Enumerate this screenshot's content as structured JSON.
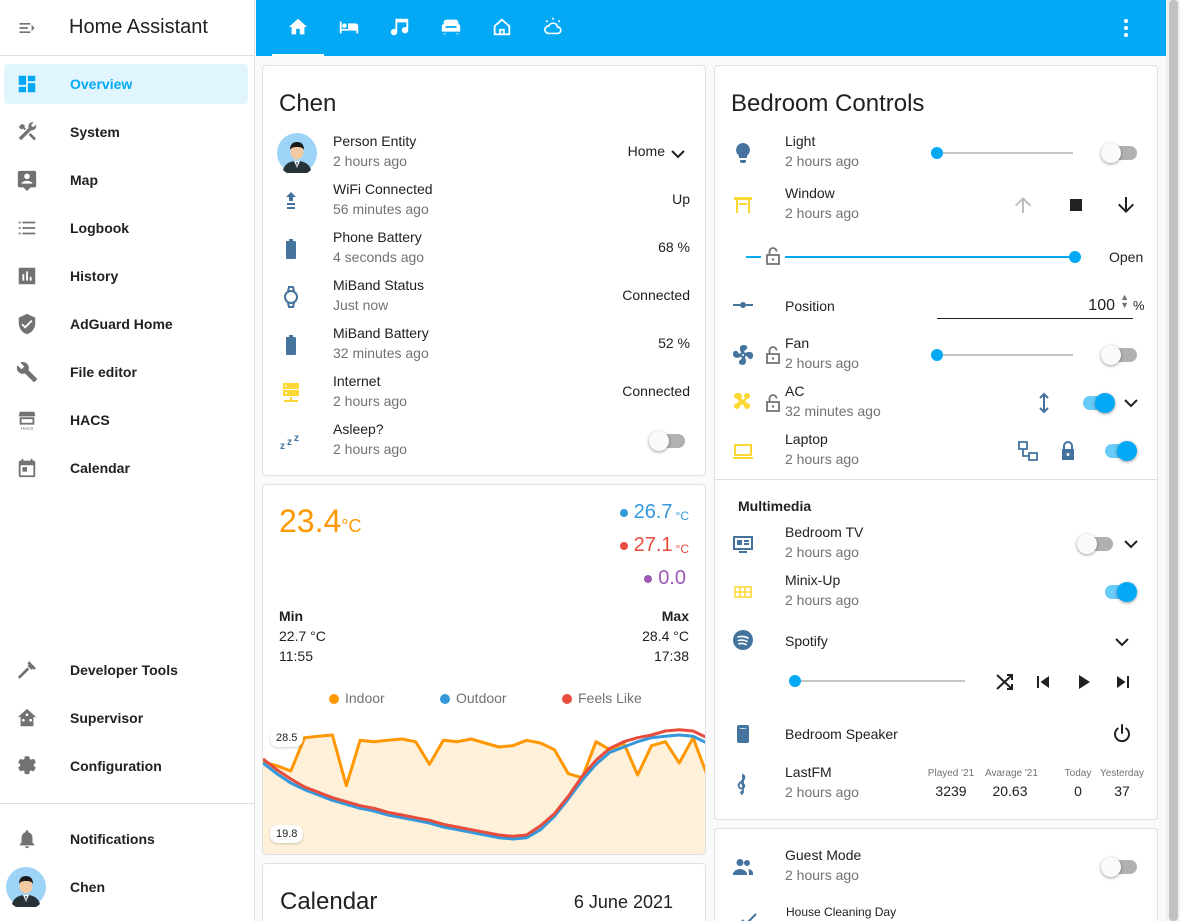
{
  "app": {
    "title": "Home Assistant"
  },
  "sidebar": {
    "items": [
      {
        "label": "Overview",
        "icon": "dashboard-icon",
        "active": true
      },
      {
        "label": "System",
        "icon": "tools-icon"
      },
      {
        "label": "Map",
        "icon": "map-account-icon"
      },
      {
        "label": "Logbook",
        "icon": "logbook-icon"
      },
      {
        "label": "History",
        "icon": "chart-box-icon"
      },
      {
        "label": "AdGuard Home",
        "icon": "shield-check-icon"
      },
      {
        "label": "File editor",
        "icon": "wrench-icon"
      },
      {
        "label": "HACS",
        "icon": "hacs-icon"
      },
      {
        "label": "Calendar",
        "icon": "calendar-icon"
      },
      {
        "label": "Developer Tools",
        "icon": "hammer-icon"
      },
      {
        "label": "Supervisor",
        "icon": "home-assistant-icon"
      },
      {
        "label": "Configuration",
        "icon": "cog-icon"
      },
      {
        "label": "Notifications",
        "icon": "bell-icon"
      },
      {
        "label": "Chen",
        "icon": "avatar"
      }
    ]
  },
  "tabs": [
    "home-icon",
    "bed-icon",
    "music-icon",
    "sofa-icon",
    "home-outline-icon",
    "weather-icon"
  ],
  "chen": {
    "title": "Chen",
    "rows": [
      {
        "name": "Person Entity",
        "sub": "2 hours ago",
        "value": "Home",
        "icon": "avatar"
      },
      {
        "name": "WiFi Connected",
        "sub": "56 minutes ago",
        "value": "Up",
        "icon": "upload-network-icon"
      },
      {
        "name": "Phone Battery",
        "sub": "4 seconds ago",
        "value": "68 %",
        "icon": "battery-icon"
      },
      {
        "name": "MiBand Status",
        "sub": "Just now",
        "value": "Connected",
        "icon": "watch-icon"
      },
      {
        "name": "MiBand Battery",
        "sub": "32 minutes ago",
        "value": "52 %",
        "icon": "battery-icon"
      },
      {
        "name": "Internet",
        "sub": "2 hours ago",
        "value": "Connected",
        "icon": "server-network-icon"
      },
      {
        "name": "Asleep?",
        "sub": "2 hours ago",
        "value": "",
        "icon": "sleep-icon",
        "toggle": false
      }
    ]
  },
  "temp": {
    "main": "23.4",
    "unit": "°C",
    "small_unit": "°C",
    "side": [
      {
        "value": "26.7",
        "unit": "°C",
        "color": "#3498db"
      },
      {
        "value": "27.1",
        "unit": "°C",
        "color": "#e74c3c"
      },
      {
        "value": "0.0",
        "unit": "",
        "color": "#9b59b6"
      }
    ],
    "min_label": "Min",
    "min_value": "22.7 °C",
    "min_time": "11:55",
    "max_label": "Max",
    "max_value": "28.4 °C",
    "max_time": "17:38",
    "legend": [
      {
        "name": "Indoor",
        "color": "#ff9800"
      },
      {
        "name": "Outdoor",
        "color": "#3498db"
      },
      {
        "name": "Feels Like",
        "color": "#e74c3c"
      }
    ],
    "y_top": "28.5",
    "y_bottom": "19.8"
  },
  "chart_data": {
    "type": "line",
    "title": "",
    "series": [
      {
        "name": "Indoor",
        "color": "#ff9800",
        "values": [
          25.9,
          25.6,
          25.2,
          27.7,
          27.8,
          27.9,
          24.1,
          27.5,
          27.4,
          27.5,
          27.6,
          27.4,
          25.7,
          27.5,
          27.4,
          27.6,
          27.3,
          27.0,
          27.1,
          27.5,
          27.3,
          26.8,
          25.0,
          24.7,
          27.4,
          26.8,
          27.3,
          24.9,
          27.1,
          27.4,
          25.8,
          27.7,
          24.9
        ]
      },
      {
        "name": "Outdoor",
        "color": "#3498db",
        "values": [
          25.8,
          25.0,
          24.3,
          23.8,
          23.4,
          23.0,
          22.7,
          22.4,
          22.2,
          21.9,
          21.7,
          21.5,
          21.3,
          21.0,
          20.8,
          20.6,
          20.4,
          20.2,
          20.1,
          20.2,
          20.8,
          21.8,
          23.1,
          24.5,
          25.7,
          26.6,
          27.0,
          27.4,
          27.7,
          27.8,
          27.9,
          27.8,
          27.3
        ]
      },
      {
        "name": "Feels Like",
        "color": "#e74c3c",
        "values": [
          26.1,
          25.3,
          24.6,
          24.0,
          23.6,
          23.2,
          22.9,
          22.6,
          22.4,
          22.1,
          21.9,
          21.7,
          21.5,
          21.2,
          21.0,
          20.8,
          20.6,
          20.4,
          20.3,
          20.4,
          21.1,
          22.0,
          23.3,
          24.8,
          26.0,
          26.9,
          27.4,
          27.7,
          27.9,
          28.2,
          28.3,
          28.2,
          27.7
        ]
      }
    ],
    "ylim": [
      19.8,
      28.5
    ]
  },
  "calendar": {
    "title": "Calendar",
    "date": "6 June 2021"
  },
  "bedroom": {
    "title": "Bedroom Controls",
    "light": {
      "name": "Light",
      "sub": "2 hours ago",
      "level": 0,
      "on": false
    },
    "window": {
      "name": "Window",
      "sub": "2 hours ago",
      "open_label": "Open",
      "position": 100
    },
    "position": {
      "name": "Position",
      "value": "100",
      "unit": "%"
    },
    "fan": {
      "name": "Fan",
      "sub": "2 hours ago",
      "level": 0,
      "on": false
    },
    "ac": {
      "name": "AC",
      "sub": "32 minutes ago",
      "on": true
    },
    "laptop": {
      "name": "Laptop",
      "sub": "2 hours ago",
      "on": true
    },
    "multimedia": "Multimedia",
    "tv": {
      "name": "Bedroom TV",
      "sub": "2 hours ago",
      "on": false
    },
    "minix": {
      "name": "Minix-Up",
      "sub": "2 hours ago",
      "on": true
    },
    "spotify": {
      "name": "Spotify",
      "volume": 0
    },
    "speaker": {
      "name": "Bedroom Speaker"
    },
    "lastfm": {
      "name": "LastFM",
      "sub": "2 hours ago",
      "stats": [
        {
          "label": "Played '21",
          "value": "3239"
        },
        {
          "label": "Avarage '21",
          "value": "20.63"
        },
        {
          "label": "Today",
          "value": "0"
        },
        {
          "label": "Yesterday",
          "value": "37"
        }
      ]
    }
  },
  "guest": {
    "name": "Guest Mode",
    "sub": "2 hours ago",
    "on": false,
    "next": "House Cleaning Day"
  }
}
